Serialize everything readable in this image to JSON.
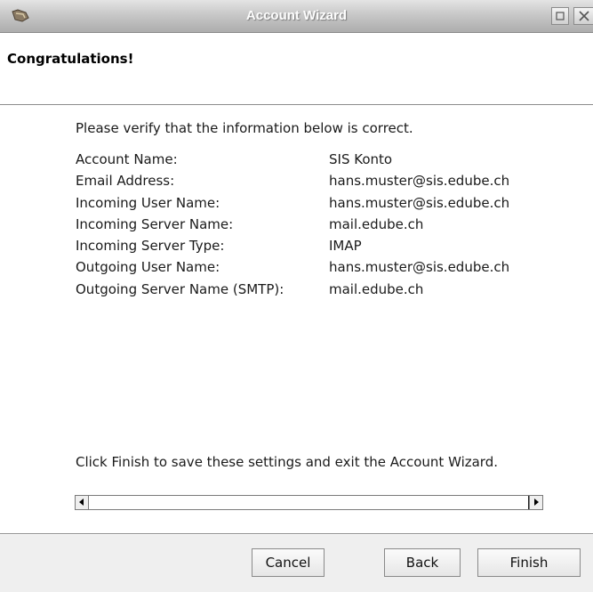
{
  "window": {
    "title": "Account Wizard"
  },
  "header": {
    "title": "Congratulations!"
  },
  "content": {
    "intro": "Please verify that the information below is correct.",
    "rows": [
      {
        "key": "Account Name:",
        "value": "SIS Konto"
      },
      {
        "key": "Email Address:",
        "value": "hans.muster@sis.edube.ch"
      },
      {
        "key": "Incoming User Name:",
        "value": "hans.muster@sis.edube.ch"
      },
      {
        "key": "Incoming Server Name:",
        "value": "mail.edube.ch"
      },
      {
        "key": "Incoming Server Type:",
        "value": "IMAP"
      },
      {
        "key": "Outgoing User Name:",
        "value": "hans.muster@sis.edube.ch"
      },
      {
        "key": "Outgoing Server Name (SMTP):",
        "value": "mail.edube.ch"
      }
    ],
    "finish_message": "Click Finish to save these settings and exit the Account Wizard."
  },
  "footer": {
    "cancel_label": "Cancel",
    "back_label": "Back",
    "finish_label": "Finish"
  },
  "icons": {
    "app": "thunderbird-wizard-icon",
    "maximize": "maximize-icon",
    "close": "close-icon",
    "scroll_left": "arrow-left-icon",
    "scroll_right": "arrow-right-icon"
  }
}
